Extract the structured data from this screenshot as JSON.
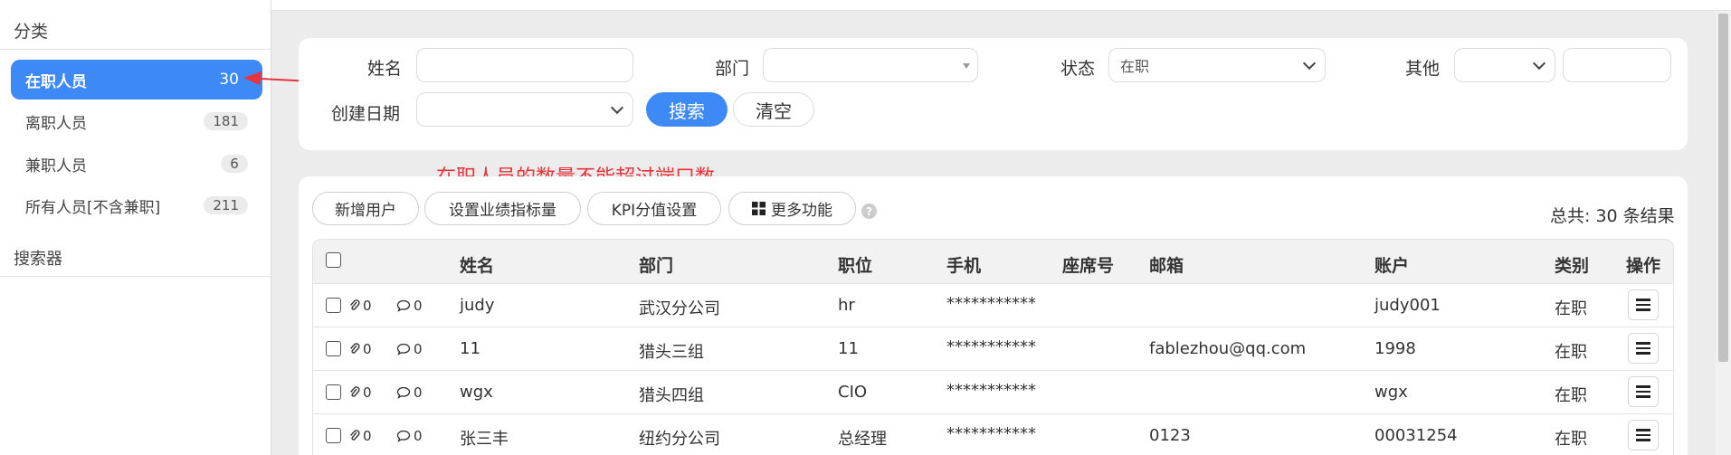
{
  "sidebar": {
    "title": "分类",
    "items": [
      {
        "label": "在职人员",
        "count": "30"
      },
      {
        "label": "离职人员",
        "count": "181"
      },
      {
        "label": "兼职人员",
        "count": "6"
      },
      {
        "label": "所有人员[不含兼职]",
        "count": "211"
      }
    ],
    "searcher_label": "搜索器"
  },
  "filters": {
    "name_label": "姓名",
    "name_value": "",
    "dept_label": "部门",
    "dept_value": "",
    "status_label": "状态",
    "status_value": "在职",
    "other_label": "其他",
    "other_select_value": "",
    "other_input_value": "",
    "created_label": "创建日期",
    "created_value": "",
    "search_button": "搜索",
    "clear_button": "清空"
  },
  "annotation": {
    "text": "在职人员的数量不能超过端口数",
    "color": "#e8333a"
  },
  "toolbar": {
    "add_user": "新增用户",
    "set_target": "设置业绩指标量",
    "kpi": "KPI分值设置",
    "more": "更多功能",
    "help": "?",
    "total": "总共: 30 条结果"
  },
  "table": {
    "headers": {
      "name": "姓名",
      "dept": "部门",
      "position": "职位",
      "phone": "手机",
      "seat": "座席号",
      "email": "邮箱",
      "account": "账户",
      "category": "类别",
      "action": "操作"
    },
    "rows": [
      {
        "attach": "0",
        "comments": "0",
        "name": "judy",
        "dept": "武汉分公司",
        "position": "hr",
        "phone": "***********",
        "seat": "",
        "email": "",
        "account": "judy001",
        "category": "在职"
      },
      {
        "attach": "0",
        "comments": "0",
        "name": "11",
        "dept": "猎头三组",
        "position": "11",
        "phone": "***********",
        "seat": "",
        "email": "fablezhou@qq.com",
        "account": "1998",
        "category": "在职"
      },
      {
        "attach": "0",
        "comments": "0",
        "name": "wgx",
        "dept": "猎头四组",
        "position": "CIO",
        "phone": "***********",
        "seat": "",
        "email": "",
        "account": "wgx",
        "category": "在职"
      },
      {
        "attach": "0",
        "comments": "0",
        "name": "张三丰",
        "dept": "纽约分公司",
        "position": "总经理",
        "phone": "***********",
        "seat": "",
        "email": "0123",
        "account": "00031254",
        "category": "在职"
      }
    ]
  },
  "colors": {
    "accent": "#3d8af7",
    "annotation": "#e8333a"
  }
}
